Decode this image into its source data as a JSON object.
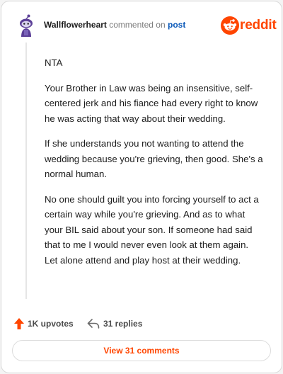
{
  "header": {
    "username": "Wallflowerheart",
    "commented_on": "commented on",
    "post_link": "post",
    "brand": "reddit"
  },
  "comment": {
    "paragraphs": [
      "NTA",
      "Your Brother in Law was being an insensitive, self-centered jerk and his fiance had every right to know he was acting that way about their wedding.",
      "If she understands you not wanting to attend the wedding because you're grieving, then good. She's a normal human.",
      "No one should guilt you into forcing yourself to act a certain way while you're grieving. And as to what your BIL said about your son. If someone had said that to me I would never even look at them again. Let alone attend and play host at their wedding."
    ]
  },
  "actions": {
    "upvotes": "1K upvotes",
    "replies": "31 replies"
  },
  "footer": {
    "view_comments": "View 31 comments"
  },
  "colors": {
    "brand": "#ff4500",
    "link": "#0a58b8",
    "avatar": "#5b3f97"
  },
  "icons": [
    "snoo-avatar-icon",
    "reddit-logo-icon",
    "upvote-arrow-icon",
    "reply-arrow-icon"
  ]
}
